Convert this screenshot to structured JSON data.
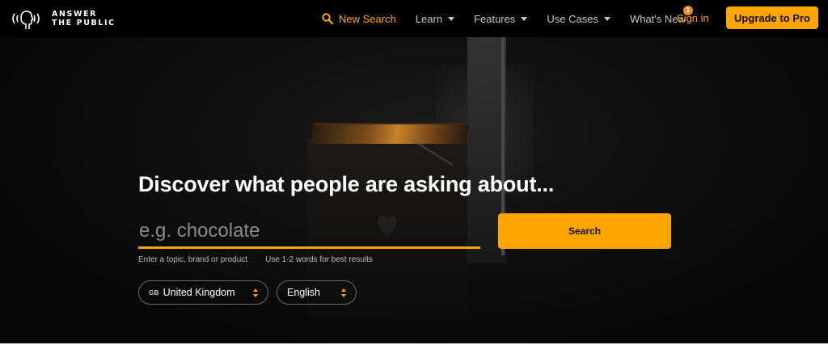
{
  "brand": {
    "line1": "ANSWER",
    "line2": "THE PUBLIC"
  },
  "nav": {
    "new_search": "New Search",
    "learn": "Learn",
    "features": "Features",
    "use_cases": "Use Cases",
    "whats_new": "What's New",
    "whats_new_badge": "1",
    "sign_in": "Sign in",
    "upgrade": "Upgrade to Pro"
  },
  "hero": {
    "headline": "Discover what people are asking about...",
    "search_placeholder": "e.g. chocolate",
    "search_value": "",
    "search_button": "Search",
    "hint_left": "Enter a topic, brand or product",
    "hint_right": "Use 1-2 words for best results",
    "country_code": "GB",
    "country": "United Kingdom",
    "language": "English"
  },
  "colors": {
    "accent": "#ffa500",
    "nav_bg": "#000000",
    "page_bg": "#0b0b0b"
  }
}
